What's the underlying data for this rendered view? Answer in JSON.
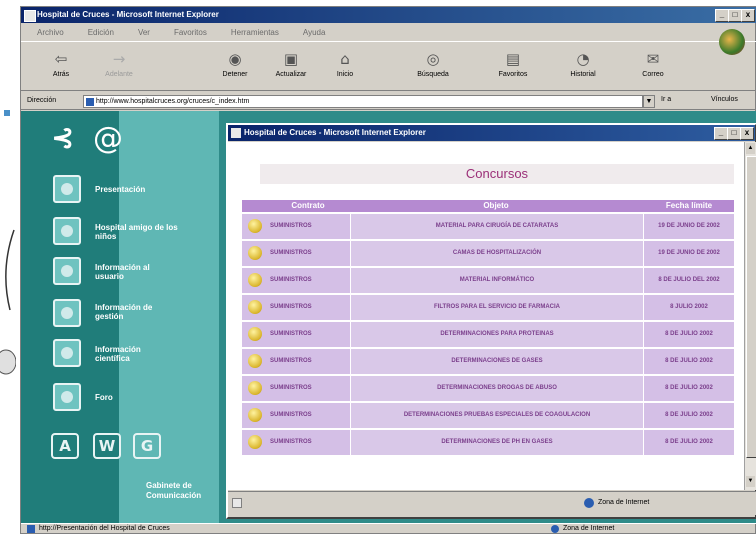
{
  "window": {
    "title": "Hospital de Cruces - Microsoft Internet Explorer",
    "controls": [
      "_",
      "□",
      "x"
    ]
  },
  "menu": [
    "Archivo",
    "Edición",
    "Ver",
    "Favoritos",
    "Herramientas",
    "Ayuda"
  ],
  "toolbar": [
    {
      "label": "Atrás",
      "icon": "back-arrow-icon",
      "glyph": "⇦",
      "enabled": true
    },
    {
      "label": "Adelante",
      "icon": "forward-arrow-icon",
      "glyph": "→",
      "enabled": false
    },
    {
      "label": "Detener",
      "icon": "stop-icon",
      "glyph": "◉",
      "enabled": true
    },
    {
      "label": "Actualizar",
      "icon": "refresh-icon",
      "glyph": "▣",
      "enabled": true
    },
    {
      "label": "Inicio",
      "icon": "home-icon",
      "glyph": "⌂",
      "enabled": true
    },
    {
      "label": "Búsqueda",
      "icon": "search-icon",
      "glyph": "◎",
      "enabled": true
    },
    {
      "label": "Favoritos",
      "icon": "favorites-icon",
      "glyph": "▤",
      "enabled": true
    },
    {
      "label": "Historial",
      "icon": "history-icon",
      "glyph": "◔",
      "enabled": true
    },
    {
      "label": "Correo",
      "icon": "mail-icon",
      "glyph": "✉",
      "enabled": true
    }
  ],
  "address": {
    "label": "Dirección",
    "url": "http://www.hospitalcruces.org/cruces/c_index.htm",
    "go": "Ir a",
    "links": "Vínculos"
  },
  "sidebar": {
    "logo_glyph": "⊰",
    "at_glyph": "@",
    "items": [
      {
        "label": "Presentación"
      },
      {
        "label": "Hospital amigo de los niños"
      },
      {
        "label": "Información al usuario"
      },
      {
        "label": "Información de gestión"
      },
      {
        "label": "Información científica"
      },
      {
        "label": "Foro"
      }
    ],
    "badges": [
      "A",
      "W",
      "G"
    ],
    "footer": "Gabinete de Comunicación"
  },
  "popup": {
    "title": "Hospital de Cruces - Microsoft Internet Explorer",
    "heading": "Concursos",
    "columns": [
      "Contrato",
      "Objeto",
      "Fecha límite"
    ],
    "rows": [
      {
        "contrato": "SUMINISTROS",
        "objeto": "MATERIAL PARA CIRUGÍA DE CATARATAS",
        "fecha": "19 DE JUNIO DE 2002"
      },
      {
        "contrato": "SUMINISTROS",
        "objeto": "CAMAS DE HOSPITALIZACIÓN",
        "fecha": "19 DE JUNIO DE 2002"
      },
      {
        "contrato": "SUMINISTROS",
        "objeto": "MATERIAL INFORMÁTICO",
        "fecha": "8 DE JULIO DEL 2002"
      },
      {
        "contrato": "SUMINISTROS",
        "objeto": "FILTROS PARA EL SERVICIO DE FARMACIA",
        "fecha": "8 JULIO 2002"
      },
      {
        "contrato": "SUMINISTROS",
        "objeto": "DETERMINACIONES PARA PROTEINAS",
        "fecha": "8 DE JULIO 2002"
      },
      {
        "contrato": "SUMINISTROS",
        "objeto": "DETERMINACIONES DE GASES",
        "fecha": "8 DE JULIO 2002"
      },
      {
        "contrato": "SUMINISTROS",
        "objeto": "DETERMINACIONES DROGAS DE ABUSO",
        "fecha": "8 DE JULIO 2002"
      },
      {
        "contrato": "SUMINISTROS",
        "objeto": "DETERMINACIONES PRUEBAS ESPECIALES DE COAGULACION",
        "fecha": "8 DE JULIO 2002"
      },
      {
        "contrato": "SUMINISTROS",
        "objeto": "DETERMINACIONES DE PH EN GASES",
        "fecha": "8 DE JULIO 2002"
      }
    ],
    "status_zone": "Zona de Internet"
  },
  "statusbar": {
    "text": "http://Presentación del Hospital de Cruces",
    "zone": "Zona de Internet"
  },
  "colors": {
    "teal": "#2f8b89",
    "purple_header": "#b58ad1",
    "row_bg": "#d4bfe6",
    "heading_text": "#9b2f78"
  }
}
